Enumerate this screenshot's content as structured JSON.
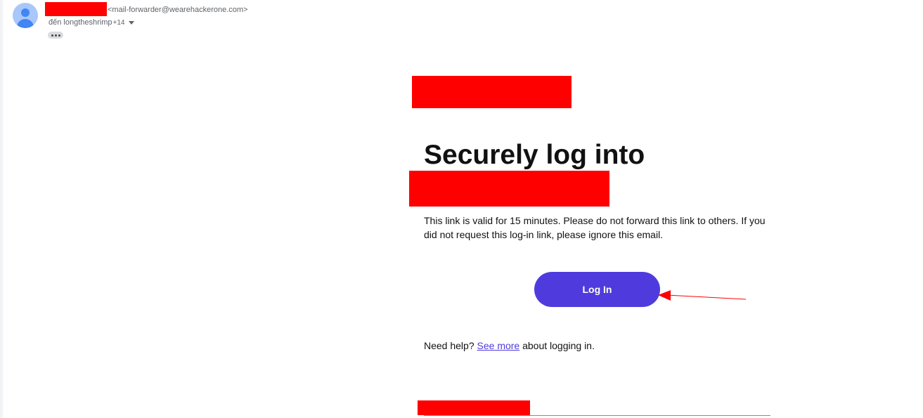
{
  "header": {
    "sender_email": "<mail-forwarder@wearehackerone.com>",
    "recipients_label": "đến longtheshrimp",
    "recipients_more": "+14",
    "more_options_icon": "ellipsis-icon",
    "avatar_icon": "person-icon"
  },
  "email": {
    "headline": "Securely log into",
    "body": "This link is valid for 15 minutes. Please do not forward this link to others. If you did not request this log-in link, please ignore this email.",
    "button_label": "Log In",
    "help_prefix": "Need help?",
    "help_link": "See more",
    "help_suffix": "about logging in."
  },
  "colors": {
    "button": "#4f3bdd",
    "link": "#4f3bdd",
    "redaction": "#ff0000",
    "annotation_arrow": "#ff0000"
  }
}
